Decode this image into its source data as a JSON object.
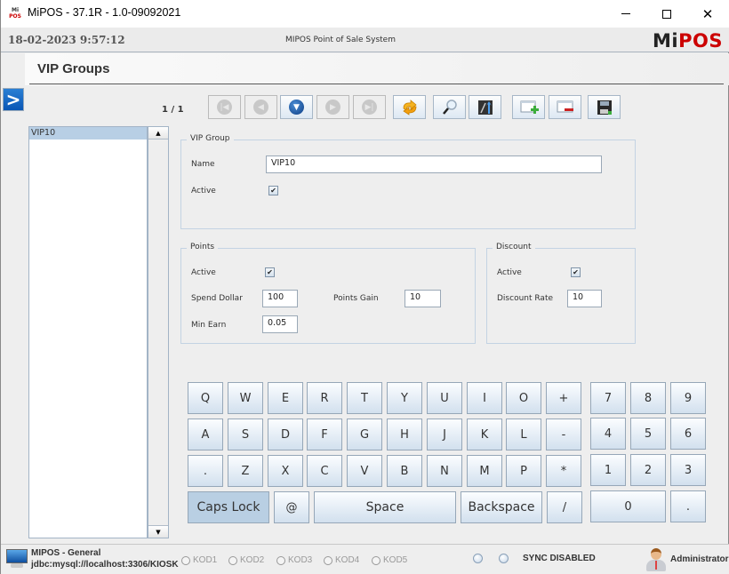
{
  "window": {
    "title": "MiPOS - 37.1R - 1.0-09092021",
    "app_icon_top": "Mi",
    "app_icon_bottom": "POS",
    "minimize_icon": "minimize-icon",
    "maximize_icon": "maximize-icon",
    "close_glyph": "✕"
  },
  "header": {
    "datetime": "18-02-2023 9:57:12",
    "system_name": "MIPOS Point of Sale System",
    "brand_part1": "Mi",
    "brand_part2": "POS",
    "brand_colors": {
      "dark": "#222222",
      "red": "#cc0000"
    }
  },
  "sidebar_toggle": {
    "glyph": ">"
  },
  "page": {
    "title": "VIP Groups"
  },
  "toolbar": {
    "record_count": "1 / 1",
    "buttons": [
      {
        "name": "first-record",
        "icon": "skip-first-icon",
        "glyph": "⏮",
        "enabled": false
      },
      {
        "name": "previous-record",
        "icon": "previous-icon",
        "glyph": "◀",
        "enabled": false
      },
      {
        "name": "down",
        "icon": "down-icon",
        "glyph": "▼",
        "enabled": true
      },
      {
        "name": "next-record",
        "icon": "next-icon",
        "glyph": "▶",
        "enabled": false
      },
      {
        "name": "last-record",
        "icon": "skip-last-icon",
        "glyph": "⏭",
        "enabled": false
      },
      {
        "name": "refresh",
        "icon": "refresh-icon",
        "enabled": true
      },
      {
        "name": "search",
        "icon": "search-icon",
        "enabled": true
      },
      {
        "name": "sort",
        "icon": "sort-icon",
        "enabled": true
      },
      {
        "name": "new-record",
        "icon": "add-record-icon",
        "enabled": true
      },
      {
        "name": "delete-record",
        "icon": "delete-record-icon",
        "enabled": true
      },
      {
        "name": "save",
        "icon": "save-icon",
        "enabled": true
      }
    ]
  },
  "list": {
    "items": [
      {
        "label": "VIP10",
        "selected": true
      }
    ],
    "scroll_up_glyph": "▲",
    "scroll_down_glyph": "▼"
  },
  "vip_group": {
    "legend": "VIP Group",
    "name_label": "Name",
    "name_value": "VIP10",
    "active_label": "Active",
    "active_checked": true
  },
  "points": {
    "legend": "Points",
    "active_label": "Active",
    "active_checked": true,
    "spend_dollar_label": "Spend Dollar",
    "spend_dollar_value": "100",
    "points_gain_label": "Points Gain",
    "points_gain_value": "10",
    "min_earn_label": "Min Earn",
    "min_earn_value": "0.05"
  },
  "discount": {
    "legend": "Discount",
    "active_label": "Active",
    "active_checked": true,
    "rate_label": "Discount Rate",
    "rate_value": "10"
  },
  "checkmark_glyph": "✔",
  "keyboard": {
    "rows": [
      [
        "Q",
        "W",
        "E",
        "R",
        "T",
        "Y",
        "U",
        "I",
        "O",
        "+"
      ],
      [
        "A",
        "S",
        "D",
        "F",
        "G",
        "H",
        "J",
        "K",
        "L",
        "-"
      ],
      [
        ".",
        "Z",
        "X",
        "C",
        "V",
        "B",
        "N",
        "M",
        "P",
        "*"
      ]
    ],
    "bottom": {
      "caps_lock": "Caps Lock",
      "at": "@",
      "space": "Space",
      "backspace": "Backspace",
      "slash": "/"
    },
    "numpad": [
      [
        "7",
        "8",
        "9"
      ],
      [
        "4",
        "5",
        "6"
      ],
      [
        "1",
        "2",
        "3"
      ]
    ],
    "numpad_bottom": {
      "zero": "0",
      "dot": "."
    }
  },
  "status": {
    "terminal_name": "MIPOS - General",
    "db_url": "jdbc:mysql://localhost:3306/KIOSK",
    "kods": [
      "KOD1",
      "KOD2",
      "KOD3",
      "KOD4",
      "KOD5"
    ],
    "sync_text": "SYNC DISABLED",
    "user": "Administrator"
  }
}
